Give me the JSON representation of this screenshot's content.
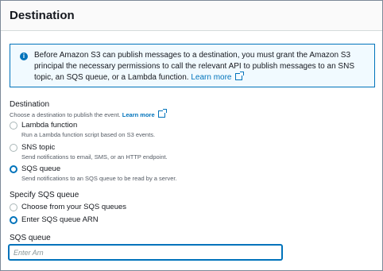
{
  "header": {
    "title": "Destination"
  },
  "info": {
    "icon": "info-icon",
    "text": "Before Amazon S3 can publish messages to a destination, you must grant the Amazon S3 principal the necessary permissions to call the relevant API to publish messages to an SNS topic, an SQS queue, or a Lambda function.",
    "link": "Learn more"
  },
  "destination": {
    "label": "Destination",
    "description": "Choose a destination to publish the event.",
    "link": "Learn more",
    "selected": "SQS queue",
    "options": [
      {
        "label": "Lambda function",
        "description": "Run a Lambda function script based on S3 events."
      },
      {
        "label": "SNS topic",
        "description": "Send notifications to email, SMS, or an HTTP endpoint."
      },
      {
        "label": "SQS queue",
        "description": "Send notifications to an SQS queue to be read by a server."
      }
    ]
  },
  "specify": {
    "label": "Specify SQS queue",
    "selected": "Enter SQS queue ARN",
    "options": [
      {
        "label": "Choose from your SQS queues"
      },
      {
        "label": "Enter SQS queue ARN"
      }
    ]
  },
  "sqs_queue": {
    "label": "SQS queue",
    "placeholder": "Enter Arn",
    "value": ""
  },
  "colors": {
    "accent": "#0073bb",
    "info_bg": "#f1faff"
  }
}
